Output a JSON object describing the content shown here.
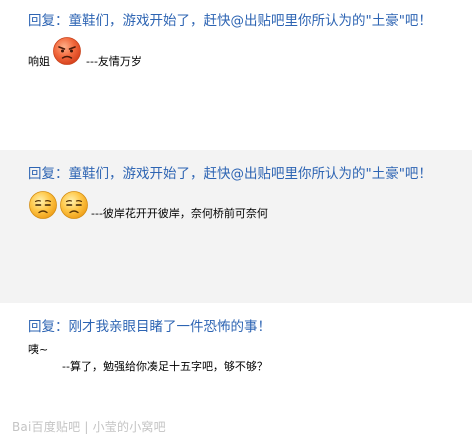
{
  "posts": [
    {
      "title": "回复：童鞋们，游戏开始了，赶快@出贴吧里你所认为的\"土豪\"吧！",
      "prefix": "响姐",
      "emoji": [
        "angry-face-icon"
      ],
      "signature": "---友情万岁"
    },
    {
      "title": "回复：童鞋们，游戏开始了，赶快@出贴吧里你所认为的\"土豪\"吧！",
      "emoji": [
        "sad-face-icon",
        "sad-face-icon"
      ],
      "signature": "---彼岸花开开彼岸，奈何桥前可奈何"
    },
    {
      "title": "回复：刚才我亲眼目睹了一件恐怖的事！",
      "line1": "咦~",
      "line2": "--算了，勉强给你凑足十五字吧，够不够？"
    }
  ],
  "watermark": {
    "text": "Bai百度贴吧 | 小莹的小窝吧"
  },
  "colors": {
    "link_blue": "#2d64b3",
    "alt_row": "#f3f3f3",
    "watermark": "#c4c4c4"
  }
}
